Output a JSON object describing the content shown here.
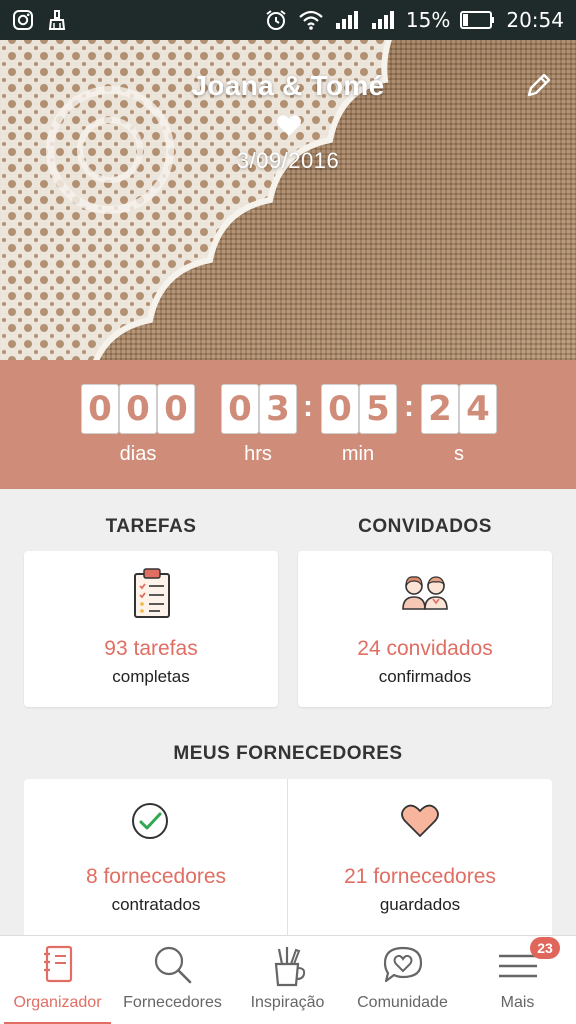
{
  "status_bar": {
    "battery_percent": "15%",
    "time": "20:54",
    "icons": [
      "instagram-icon",
      "cleaner-icon",
      "alarm-icon",
      "wifi-icon",
      "signal-icon",
      "signal-icon",
      "battery-icon"
    ]
  },
  "hero": {
    "couple_names": "Joana & Tomé",
    "date": "3/09/2016",
    "edit_icon": "pencil-icon",
    "heart_icon": "heart-icon"
  },
  "countdown": {
    "days": [
      "0",
      "0",
      "0"
    ],
    "hours": [
      "0",
      "3"
    ],
    "minutes": [
      "0",
      "5"
    ],
    "seconds": [
      "2",
      "4"
    ],
    "separator": ":",
    "labels": {
      "days": "dias",
      "hours": "hrs",
      "minutes": "min",
      "seconds": "s"
    }
  },
  "tasks": {
    "title": "TAREFAS",
    "stat": "93 tarefas",
    "sub": "completas",
    "icon": "clipboard-checklist-icon"
  },
  "guests": {
    "title": "CONVIDADOS",
    "stat": "24 convidados",
    "sub": "confirmados",
    "icon": "couple-icon"
  },
  "vendors": {
    "title": "MEUS FORNECEDORES",
    "hired": {
      "stat": "8 fornecedores",
      "sub": "contratados",
      "icon": "check-circle-icon"
    },
    "saved": {
      "stat": "21 fornecedores",
      "sub": "guardados",
      "icon": "heart-icon"
    }
  },
  "bottom_nav": {
    "items": [
      {
        "label": "Organizador",
        "icon": "notebook-icon",
        "active": true
      },
      {
        "label": "Fornecedores",
        "icon": "search-icon",
        "active": false
      },
      {
        "label": "Inspiração",
        "icon": "pencil-cup-icon",
        "active": false
      },
      {
        "label": "Comunidade",
        "icon": "chat-heart-icon",
        "active": false
      },
      {
        "label": "Mais",
        "icon": "menu-icon",
        "active": false
      }
    ],
    "badge_count": "23"
  },
  "colors": {
    "accent": "#e06e63",
    "countdown_band": "#cf8d79",
    "status_bar": "#1f2a2a",
    "background": "#efefef"
  }
}
